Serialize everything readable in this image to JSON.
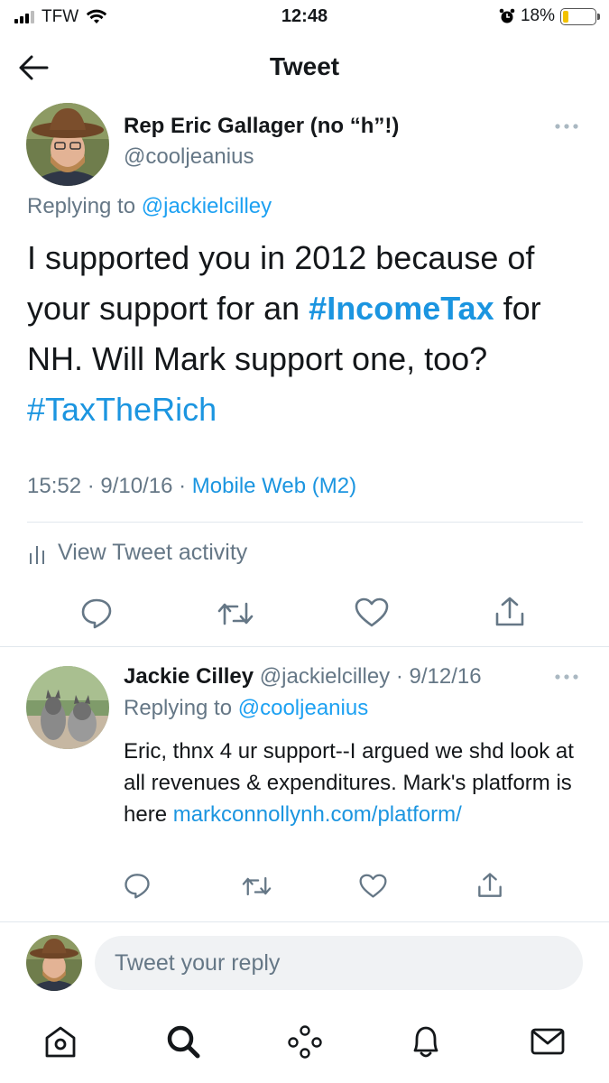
{
  "status_bar": {
    "carrier": "TFW",
    "time": "12:48",
    "battery_percent": "18%",
    "battery_level": 0.18,
    "battery_color": "#f2c200"
  },
  "header": {
    "title": "Tweet",
    "back_icon": "back-arrow-icon"
  },
  "tweet": {
    "author_name": "Rep Eric Gallager (no “h”!)",
    "author_handle": "@cooljeanius",
    "replying_prefix": "Replying to ",
    "replying_to": "@jackielcilley",
    "text_1": "I supported you in 2012 because of your support for an ",
    "hashtag_1": "#IncomeTax",
    "text_2": " for NH. Will Mark support one, too? ",
    "hashtag_2": "#TaxTheRich",
    "timestamp": "15:52 · 9/10/16 · ",
    "source": "Mobile Web (M2)",
    "activity_label": "View Tweet activity"
  },
  "reply": {
    "author_name": "Jackie Cilley",
    "author_handle": " @jackielcilley · 9/12/16",
    "replying_prefix": "Replying to ",
    "replying_to": "@cooljeanius",
    "text": "Eric, thnx 4 ur support--I argued we shd look at all revenues & expenditures. Mark's platform is here ",
    "link": "markconnollynh.com/platform/"
  },
  "compose": {
    "placeholder": "Tweet your reply"
  },
  "tab_bar": {
    "items": [
      "home-icon",
      "search-icon",
      "spaces-icon",
      "notifications-icon",
      "messages-icon"
    ]
  },
  "colors": {
    "link_blue": "#1b95e0",
    "secondary_text": "#657786",
    "divider": "#e1e8ed"
  }
}
